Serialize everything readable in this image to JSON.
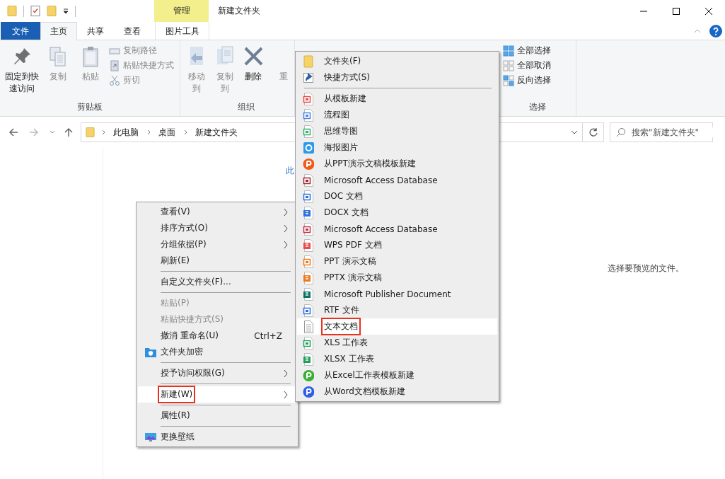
{
  "title_bar": {
    "title": "新建文件夹",
    "context_tab": "管理"
  },
  "ribbon_tabs": [
    {
      "label": "文件",
      "kind": "file",
      "selected": false
    },
    {
      "label": "主页",
      "kind": "tab",
      "selected": true
    },
    {
      "label": "共享",
      "kind": "tab",
      "selected": false
    },
    {
      "label": "查看",
      "kind": "tab",
      "selected": false
    },
    {
      "label": "图片工具",
      "kind": "context",
      "selected": false
    }
  ],
  "clipboard": {
    "label": "剪贴板",
    "large": [
      {
        "label": "固定到快速访问",
        "disabled": false
      },
      {
        "label": "复制",
        "disabled": true
      },
      {
        "label": "粘贴",
        "disabled": true
      }
    ],
    "small": [
      {
        "label": "复制路径",
        "disabled": true
      },
      {
        "label": "粘贴快捷方式",
        "disabled": true
      },
      {
        "label": "剪切",
        "disabled": true
      }
    ]
  },
  "organize": {
    "label": "组织",
    "buttons": [
      {
        "label": "移动到",
        "disabled": true
      },
      {
        "label": "复制到",
        "disabled": true
      },
      {
        "label": "删除",
        "disabled": false
      },
      {
        "label": "重",
        "disabled": true
      }
    ]
  },
  "select": {
    "label": "选择",
    "buttons": [
      {
        "label": "全部选择"
      },
      {
        "label": "全部取消"
      },
      {
        "label": "反向选择"
      }
    ]
  },
  "address": {
    "path": [
      "此电脑",
      "桌面",
      "新建文件夹"
    ],
    "search_placeholder": "搜索\"新建文件夹\""
  },
  "content": {
    "empty_text": "此",
    "preview_text": "选择要预览的文件。"
  },
  "context_menu": [
    {
      "kind": "item",
      "label": "查看(V)",
      "submenu": true,
      "disabled": false,
      "selected": false,
      "marked": false
    },
    {
      "kind": "item",
      "label": "排序方式(O)",
      "submenu": true,
      "disabled": false,
      "selected": false,
      "marked": false
    },
    {
      "kind": "item",
      "label": "分组依据(P)",
      "submenu": true,
      "disabled": false,
      "selected": false,
      "marked": false
    },
    {
      "kind": "item",
      "label": "刷新(E)",
      "submenu": false,
      "disabled": false,
      "selected": false,
      "marked": false
    },
    {
      "kind": "separator"
    },
    {
      "kind": "item",
      "label": "自定义文件夹(F)...",
      "submenu": false,
      "disabled": false,
      "selected": false,
      "marked": false
    },
    {
      "kind": "separator"
    },
    {
      "kind": "item",
      "label": "粘贴(P)",
      "submenu": false,
      "disabled": true,
      "selected": false,
      "marked": false
    },
    {
      "kind": "item",
      "label": "粘贴快捷方式(S)",
      "submenu": false,
      "disabled": true,
      "selected": false,
      "marked": false
    },
    {
      "kind": "item",
      "label": "撤消 重命名(U)",
      "shortcut": "Ctrl+Z",
      "submenu": false,
      "disabled": false,
      "selected": false,
      "marked": false
    },
    {
      "kind": "item",
      "label": "文件夹加密",
      "submenu": false,
      "disabled": false,
      "selected": false,
      "marked": false
    },
    {
      "kind": "separator"
    },
    {
      "kind": "item",
      "label": "授予访问权限(G)",
      "submenu": true,
      "disabled": false,
      "selected": false,
      "marked": false
    },
    {
      "kind": "separator"
    },
    {
      "kind": "item",
      "label": "新建(W)",
      "submenu": true,
      "disabled": false,
      "selected": true,
      "marked": true
    },
    {
      "kind": "separator"
    },
    {
      "kind": "item",
      "label": "属性(R)",
      "submenu": false,
      "disabled": false,
      "selected": false,
      "marked": false
    },
    {
      "kind": "separator"
    },
    {
      "kind": "item",
      "label": "更换壁纸",
      "submenu": false,
      "disabled": false,
      "selected": false,
      "marked": false
    }
  ],
  "new_submenu": [
    {
      "kind": "item",
      "label": "文件夹(F)",
      "selected": false,
      "marked": false
    },
    {
      "kind": "item",
      "label": "快捷方式(S)",
      "selected": false,
      "marked": false
    },
    {
      "kind": "separator"
    },
    {
      "kind": "item",
      "label": "从模板新建",
      "selected": false,
      "marked": false
    },
    {
      "kind": "item",
      "label": "流程图",
      "selected": false,
      "marked": false
    },
    {
      "kind": "item",
      "label": "思维导图",
      "selected": false,
      "marked": false
    },
    {
      "kind": "item",
      "label": "海报图片",
      "selected": false,
      "marked": false
    },
    {
      "kind": "item",
      "label": "从PPT演示文稿模板新建",
      "selected": false,
      "marked": false
    },
    {
      "kind": "item",
      "label": "Microsoft Access Database",
      "selected": false,
      "marked": false
    },
    {
      "kind": "item",
      "label": "DOC 文档",
      "selected": false,
      "marked": false
    },
    {
      "kind": "item",
      "label": "DOCX 文档",
      "selected": false,
      "marked": false
    },
    {
      "kind": "item",
      "label": "Microsoft Access Database",
      "selected": false,
      "marked": false
    },
    {
      "kind": "item",
      "label": "WPS PDF 文档",
      "selected": false,
      "marked": false
    },
    {
      "kind": "item",
      "label": "PPT 演示文稿",
      "selected": false,
      "marked": false
    },
    {
      "kind": "item",
      "label": "PPTX 演示文稿",
      "selected": false,
      "marked": false
    },
    {
      "kind": "item",
      "label": "Microsoft Publisher Document",
      "selected": false,
      "marked": false
    },
    {
      "kind": "item",
      "label": "RTF 文件",
      "selected": false,
      "marked": false
    },
    {
      "kind": "item",
      "label": "文本文档",
      "selected": true,
      "marked": true
    },
    {
      "kind": "item",
      "label": "XLS 工作表",
      "selected": false,
      "marked": false
    },
    {
      "kind": "item",
      "label": "XLSX 工作表",
      "selected": false,
      "marked": false
    },
    {
      "kind": "item",
      "label": "从Excel工作表模板新建",
      "selected": false,
      "marked": false
    },
    {
      "kind": "item",
      "label": "从Word文档模板新建",
      "selected": false,
      "marked": false
    }
  ]
}
